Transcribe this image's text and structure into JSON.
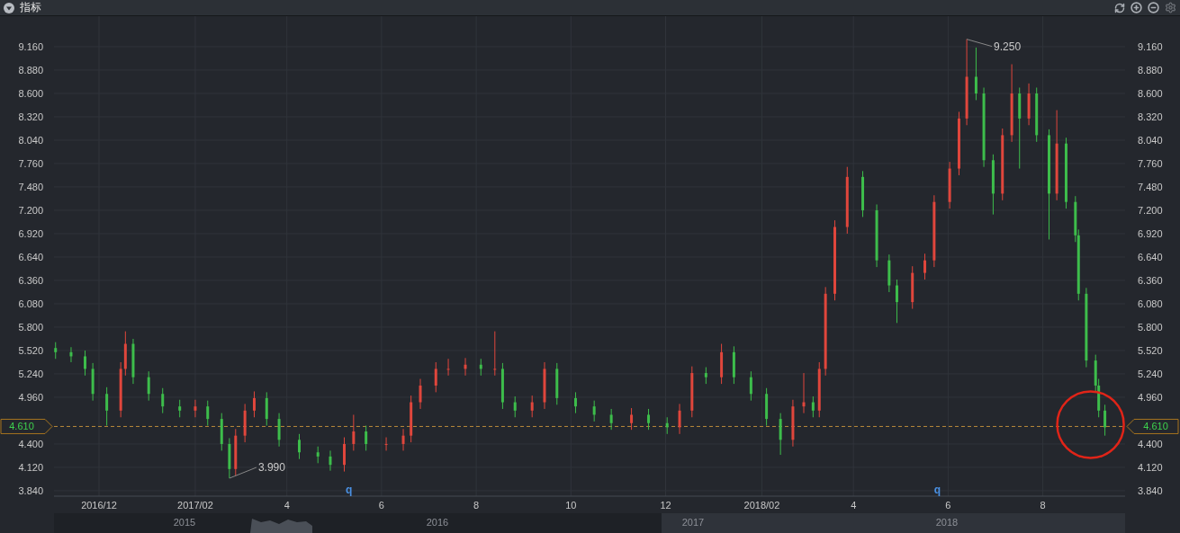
{
  "header": {
    "title": "指标"
  },
  "chart": {
    "price_tag": "4.610",
    "highlight": {
      "kind": "circle"
    },
    "chart_data": {
      "type": "candlestick",
      "grid": true,
      "xlim": [
        "2016-11-02",
        "2018-09-23"
      ],
      "ylim": [
        3.775,
        9.526
      ],
      "xticks": [
        {
          "value": "2016-12-01",
          "label": "2016/12"
        },
        {
          "value": "2017-02-01",
          "label": "2017/02"
        },
        {
          "value": "2017-04-01",
          "label": "4"
        },
        {
          "value": "2017-06-01",
          "label": "6"
        },
        {
          "value": "2017-08-01",
          "label": "8"
        },
        {
          "value": "2017-10-01",
          "label": "10"
        },
        {
          "value": "2017-12-01",
          "label": "12"
        },
        {
          "value": "2018-02-01",
          "label": "2018/02"
        },
        {
          "value": "2018-04-01",
          "label": "4"
        },
        {
          "value": "2018-06-01",
          "label": "6"
        },
        {
          "value": "2018-08-01",
          "label": "8"
        }
      ],
      "yticks": [
        {
          "value": 3.84,
          "label": "3.840"
        },
        {
          "value": 4.12,
          "label": "4.120"
        },
        {
          "value": 4.4,
          "label": "4.400"
        },
        {
          "value": 4.96,
          "label": "4.960"
        },
        {
          "value": 5.24,
          "label": "5.240"
        },
        {
          "value": 5.52,
          "label": "5.520"
        },
        {
          "value": 5.8,
          "label": "5.800"
        },
        {
          "value": 6.08,
          "label": "6.080"
        },
        {
          "value": 6.36,
          "label": "6.360"
        },
        {
          "value": 6.64,
          "label": "6.640"
        },
        {
          "value": 6.92,
          "label": "6.920"
        },
        {
          "value": 7.2,
          "label": "7.200"
        },
        {
          "value": 7.48,
          "label": "7.480"
        },
        {
          "value": 7.76,
          "label": "7.760"
        },
        {
          "value": 8.04,
          "label": "8.040"
        },
        {
          "value": 8.32,
          "label": "8.320"
        },
        {
          "value": 8.6,
          "label": "8.600"
        },
        {
          "value": 8.88,
          "label": "8.880"
        },
        {
          "value": 9.16,
          "label": "9.160"
        }
      ],
      "x": [
        "2016-11-03",
        "2016-11-13",
        "2016-11-22",
        "2016-11-27",
        "2016-12-06",
        "2016-12-15",
        "2016-12-18",
        "2016-12-23",
        "2017-01-02",
        "2017-01-11",
        "2017-01-22",
        "2017-02-01",
        "2017-02-09",
        "2017-02-18",
        "2017-02-23",
        "2017-02-27",
        "2017-03-05",
        "2017-03-11",
        "2017-03-19",
        "2017-03-27",
        "2017-04-09",
        "2017-04-21",
        "2017-04-29",
        "2017-05-08",
        "2017-05-14",
        "2017-05-22",
        "2017-06-04",
        "2017-06-15",
        "2017-06-20",
        "2017-06-26",
        "2017-07-06",
        "2017-07-14",
        "2017-07-25",
        "2017-08-04",
        "2017-08-13",
        "2017-08-18",
        "2017-08-26",
        "2017-09-06",
        "2017-09-14",
        "2017-09-22",
        "2017-10-04",
        "2017-10-16",
        "2017-10-27",
        "2017-11-09",
        "2017-11-20",
        "2017-12-02",
        "2017-12-10",
        "2017-12-18",
        "2017-12-27",
        "2018-01-06",
        "2018-01-14",
        "2018-01-25",
        "2018-02-04",
        "2018-02-13",
        "2018-02-21",
        "2018-02-28",
        "2018-03-06",
        "2018-03-10",
        "2018-03-14",
        "2018-03-20",
        "2018-03-28",
        "2018-04-07",
        "2018-04-16",
        "2018-04-24",
        "2018-04-29",
        "2018-05-09",
        "2018-05-17",
        "2018-05-23",
        "2018-06-02",
        "2018-06-08",
        "2018-06-13",
        "2018-06-19",
        "2018-06-24",
        "2018-06-30",
        "2018-07-06",
        "2018-07-12",
        "2018-07-17",
        "2018-07-23",
        "2018-07-28",
        "2018-08-05",
        "2018-08-10",
        "2018-08-16",
        "2018-08-22",
        "2018-08-24",
        "2018-08-29",
        "2018-09-04",
        "2018-09-06",
        "2018-09-10"
      ],
      "ohlc": [
        [
          5.55,
          5.62,
          5.42,
          5.5
        ],
        [
          5.5,
          5.56,
          5.38,
          5.45
        ],
        [
          5.45,
          5.52,
          5.22,
          5.3
        ],
        [
          5.3,
          5.37,
          4.92,
          5.0
        ],
        [
          5.0,
          5.08,
          4.62,
          4.8
        ],
        [
          4.8,
          5.38,
          4.72,
          5.3
        ],
        [
          5.3,
          5.75,
          5.22,
          5.6
        ],
        [
          5.6,
          5.66,
          5.12,
          5.2
        ],
        [
          5.2,
          5.27,
          4.92,
          5.0
        ],
        [
          5.0,
          5.07,
          4.77,
          4.85
        ],
        [
          4.85,
          4.93,
          4.72,
          4.8
        ],
        [
          4.8,
          4.93,
          4.72,
          4.85
        ],
        [
          4.85,
          4.92,
          4.62,
          4.7
        ],
        [
          4.7,
          4.77,
          4.32,
          4.4
        ],
        [
          4.4,
          4.47,
          3.99,
          4.1
        ],
        [
          4.1,
          4.58,
          4.02,
          4.5
        ],
        [
          4.5,
          4.88,
          4.42,
          4.8
        ],
        [
          4.8,
          5.03,
          4.72,
          4.95
        ],
        [
          4.95,
          5.02,
          4.62,
          4.7
        ],
        [
          4.7,
          4.77,
          4.37,
          4.45
        ],
        [
          4.45,
          4.52,
          4.22,
          4.3
        ],
        [
          4.3,
          4.37,
          4.17,
          4.25
        ],
        [
          4.25,
          4.32,
          4.08,
          4.15
        ],
        [
          4.15,
          4.48,
          4.07,
          4.4
        ],
        [
          4.4,
          4.75,
          4.32,
          4.55
        ],
        [
          4.55,
          4.62,
          4.32,
          4.4
        ],
        [
          4.4,
          4.48,
          4.32,
          4.4
        ],
        [
          4.4,
          4.58,
          4.32,
          4.5
        ],
        [
          4.5,
          4.98,
          4.42,
          4.9
        ],
        [
          4.9,
          5.18,
          4.82,
          5.1
        ],
        [
          5.1,
          5.38,
          5.02,
          5.3
        ],
        [
          5.3,
          5.42,
          5.22,
          5.3
        ],
        [
          5.3,
          5.43,
          5.22,
          5.35
        ],
        [
          5.35,
          5.42,
          5.22,
          5.3
        ],
        [
          5.3,
          5.75,
          5.22,
          5.3
        ],
        [
          5.3,
          5.37,
          4.82,
          4.9
        ],
        [
          4.9,
          4.97,
          4.72,
          4.8
        ],
        [
          4.8,
          4.98,
          4.72,
          4.9
        ],
        [
          4.9,
          5.38,
          4.82,
          5.3
        ],
        [
          5.3,
          5.37,
          4.87,
          4.95
        ],
        [
          4.95,
          5.02,
          4.77,
          4.85
        ],
        [
          4.85,
          4.92,
          4.67,
          4.75
        ],
        [
          4.75,
          4.82,
          4.57,
          4.65
        ],
        [
          4.65,
          4.83,
          4.57,
          4.75
        ],
        [
          4.75,
          4.82,
          4.57,
          4.65
        ],
        [
          4.65,
          4.72,
          4.52,
          4.6
        ],
        [
          4.6,
          4.88,
          4.52,
          4.8
        ],
        [
          4.8,
          5.33,
          4.72,
          5.25
        ],
        [
          5.25,
          5.32,
          5.12,
          5.2
        ],
        [
          5.2,
          5.6,
          5.12,
          5.5
        ],
        [
          5.5,
          5.57,
          5.12,
          5.2
        ],
        [
          5.2,
          5.27,
          4.92,
          5.0
        ],
        [
          5.0,
          5.07,
          4.62,
          4.7
        ],
        [
          4.7,
          4.77,
          4.27,
          4.45
        ],
        [
          4.45,
          4.93,
          4.37,
          4.85
        ],
        [
          4.85,
          5.25,
          4.77,
          4.9
        ],
        [
          4.9,
          4.97,
          4.72,
          4.8
        ],
        [
          4.8,
          5.38,
          4.72,
          5.3
        ],
        [
          5.3,
          6.28,
          5.22,
          6.2
        ],
        [
          6.2,
          7.08,
          6.12,
          7.0
        ],
        [
          7.0,
          7.72,
          6.92,
          7.6
        ],
        [
          7.6,
          7.67,
          7.12,
          7.2
        ],
        [
          7.2,
          7.27,
          6.52,
          6.6
        ],
        [
          6.6,
          6.67,
          6.22,
          6.3
        ],
        [
          6.3,
          6.37,
          5.85,
          6.1
        ],
        [
          6.1,
          6.53,
          6.02,
          6.45
        ],
        [
          6.45,
          6.68,
          6.37,
          6.6
        ],
        [
          6.6,
          7.38,
          6.52,
          7.3
        ],
        [
          7.3,
          7.78,
          7.22,
          7.7
        ],
        [
          7.7,
          8.38,
          7.62,
          8.3
        ],
        [
          8.3,
          9.25,
          8.22,
          8.8
        ],
        [
          8.8,
          9.15,
          8.52,
          8.6
        ],
        [
          8.6,
          8.67,
          7.72,
          7.8
        ],
        [
          7.8,
          7.87,
          7.15,
          7.4
        ],
        [
          7.4,
          8.18,
          7.32,
          8.1
        ],
        [
          8.1,
          8.95,
          8.02,
          8.6
        ],
        [
          8.6,
          8.67,
          7.7,
          8.3
        ],
        [
          8.3,
          8.72,
          8.22,
          8.6
        ],
        [
          8.6,
          8.67,
          8.02,
          8.1
        ],
        [
          8.1,
          8.17,
          6.85,
          7.4
        ],
        [
          7.4,
          8.4,
          7.32,
          8.0
        ],
        [
          8.0,
          8.07,
          7.22,
          7.3
        ],
        [
          7.3,
          7.37,
          6.82,
          6.9
        ],
        [
          6.9,
          6.97,
          6.12,
          6.2
        ],
        [
          6.2,
          6.27,
          5.32,
          5.4
        ],
        [
          5.4,
          5.47,
          5.02,
          5.1
        ],
        [
          5.1,
          5.18,
          4.72,
          4.8
        ],
        [
          4.8,
          4.87,
          4.5,
          4.6
        ]
      ],
      "ref_lines": [
        {
          "axis": "y",
          "value": 4.61,
          "label": "4.610"
        }
      ],
      "annotations": [
        "3.990",
        "9.250",
        "q",
        "q"
      ]
    }
  },
  "navigator": {
    "years": [
      "2015",
      "2016",
      "2017",
      "2018"
    ]
  }
}
